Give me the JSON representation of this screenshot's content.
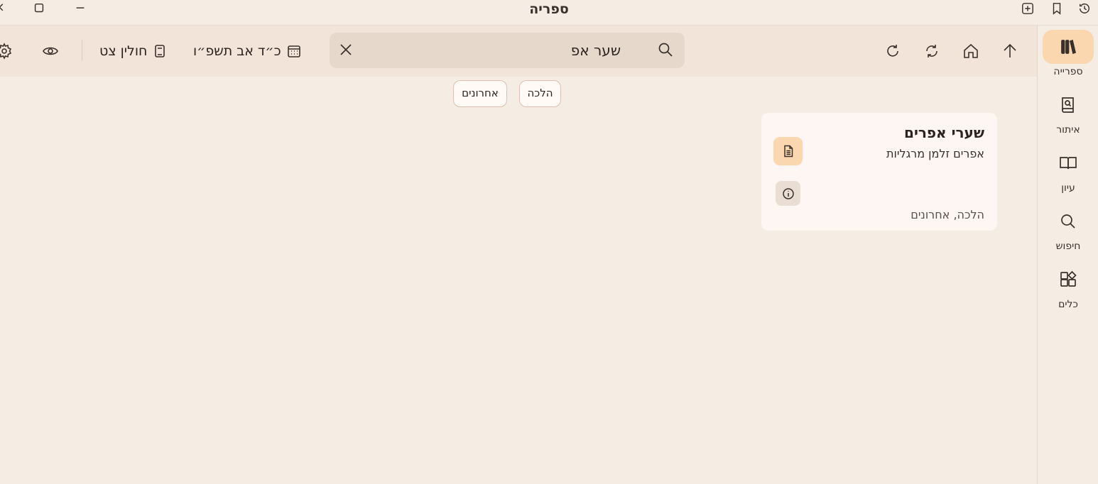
{
  "window": {
    "title": "ספריה"
  },
  "rail": {
    "items": [
      {
        "label": "ספרייה",
        "icon": "library-icon",
        "active": true
      },
      {
        "label": "איתור",
        "icon": "find-book-icon",
        "active": false
      },
      {
        "label": "עיון",
        "icon": "open-book-icon",
        "active": false
      },
      {
        "label": "חיפוש",
        "icon": "search-icon",
        "active": false
      },
      {
        "label": "כלים",
        "icon": "tools-icon",
        "active": false
      }
    ]
  },
  "search": {
    "value": "שער אפ"
  },
  "toolbar": {
    "date": "כ״ד אב תשפ״ו",
    "daf": "חולין צט"
  },
  "filters": [
    "הלכה",
    "אחרונים"
  ],
  "results": [
    {
      "title": "שערי אפרים",
      "author": "אפרים זלמן מרגליות",
      "categories": "הלכה, אחרונים"
    }
  ],
  "colors": {
    "background": "#f5ece3",
    "toolbar": "#f2e4d8",
    "accent": "#fbd7b0",
    "card": "#fdf6f2"
  }
}
